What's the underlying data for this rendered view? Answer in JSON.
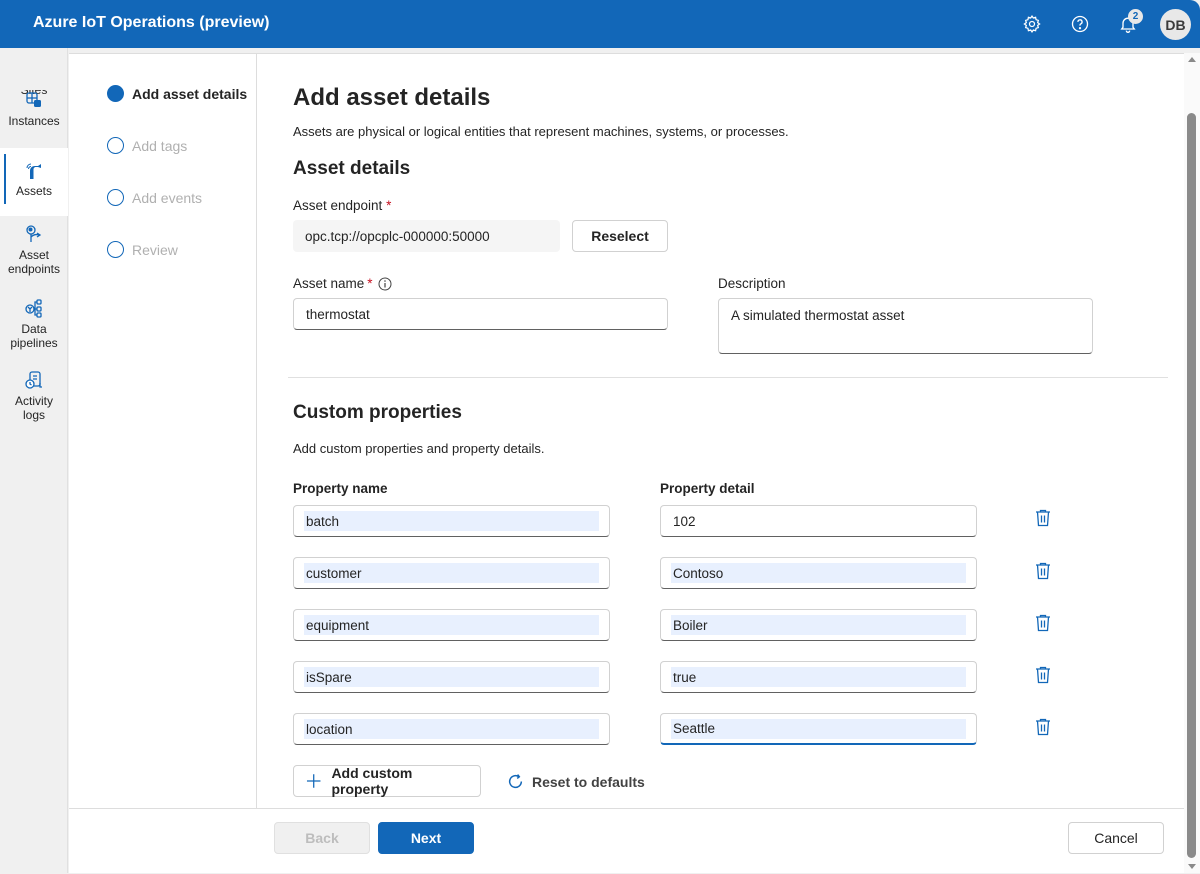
{
  "header": {
    "app_title": "Azure IoT Operations (preview)",
    "icons": [
      "gear-icon",
      "help-icon",
      "bell-icon"
    ],
    "notification_count": "2",
    "avatar_initials": "DB",
    "brand_color": "#1267b8"
  },
  "leftnav": {
    "items": [
      {
        "label": "Sites",
        "icon": "sites-icon",
        "active": false
      },
      {
        "label": "Instances",
        "icon": "instances-icon",
        "active": false
      },
      {
        "label": "Assets",
        "icon": "assets-icon",
        "active": true
      },
      {
        "label": "Asset endpoints",
        "line1": "Asset",
        "line2": "endpoints",
        "icon": "asset-endpoints-icon",
        "active": false
      },
      {
        "label": "Data pipelines",
        "line1": "Data",
        "line2": "pipelines",
        "icon": "data-pipelines-icon",
        "active": false
      },
      {
        "label": "Activity logs",
        "line1": "Activity",
        "line2": "logs",
        "icon": "activity-logs-icon",
        "active": false
      }
    ]
  },
  "wizard": {
    "steps": [
      {
        "label": "Add asset details",
        "active": true
      },
      {
        "label": "Add tags",
        "active": false
      },
      {
        "label": "Add events",
        "active": false
      },
      {
        "label": "Review",
        "active": false
      }
    ]
  },
  "main": {
    "title": "Add asset details",
    "subtitle": "Assets are physical or logical entities that represent machines, systems, or processes.",
    "asset_details_heading": "Asset details",
    "asset_endpoint_label": "Asset endpoint",
    "asset_endpoint_value": "opc.tcp://opcplc-000000:50000",
    "reselect_label": "Reselect",
    "asset_name_label": "Asset name",
    "asset_name_value": "thermostat",
    "description_label": "Description",
    "description_value": "A simulated thermostat asset",
    "required_marker": "*",
    "custom_properties_heading": "Custom properties",
    "custom_properties_subtitle": "Add custom properties and property details.",
    "property_name_header": "Property name",
    "property_detail_header": "Property detail",
    "properties": [
      {
        "name": "batch",
        "detail": "102"
      },
      {
        "name": "customer",
        "detail": "Contoso"
      },
      {
        "name": "equipment",
        "detail": "Boiler"
      },
      {
        "name": "isSpare",
        "detail": "true"
      },
      {
        "name": "location",
        "detail": "Seattle"
      }
    ],
    "add_custom_property_label": "Add custom property",
    "reset_defaults_label": "Reset to defaults"
  },
  "footer": {
    "back_label": "Back",
    "next_label": "Next",
    "cancel_label": "Cancel"
  }
}
